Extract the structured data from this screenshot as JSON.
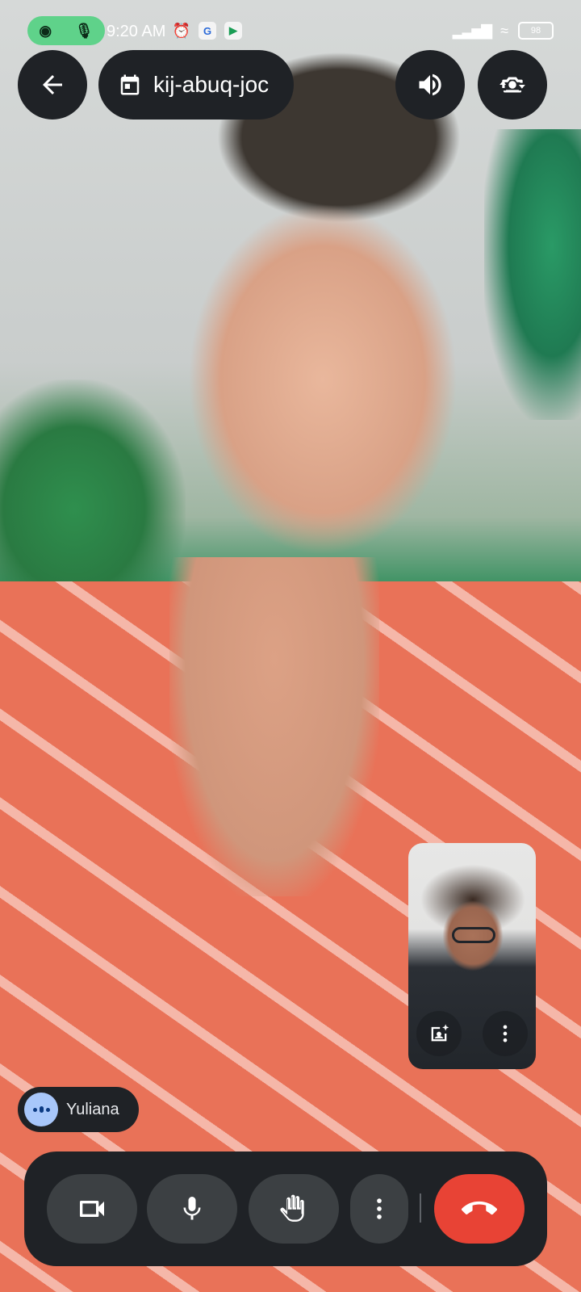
{
  "status_bar": {
    "time": "9:20 AM",
    "battery": "98",
    "icons": [
      "camera-recording-icon",
      "mic-recording-icon",
      "alarm-icon",
      "google-one-icon",
      "meet-icon",
      "signal-icon",
      "wifi-icon",
      "battery-icon"
    ]
  },
  "top_bar": {
    "meeting_code": "kij-abuq-joc",
    "icons": [
      "back-arrow-icon",
      "calendar-icon",
      "speaker-icon",
      "flip-camera-icon"
    ]
  },
  "participant": {
    "name": "Yuliana"
  },
  "self_view": {
    "icons": [
      "effects-icon",
      "more-vert-icon"
    ]
  },
  "controls": {
    "icons": [
      "video-camera-icon",
      "microphone-icon",
      "raise-hand-icon",
      "more-vert-icon",
      "end-call-icon"
    ],
    "end_call_color": "#e84335",
    "button_color": "#3c4043",
    "bar_color": "#1f2226"
  }
}
